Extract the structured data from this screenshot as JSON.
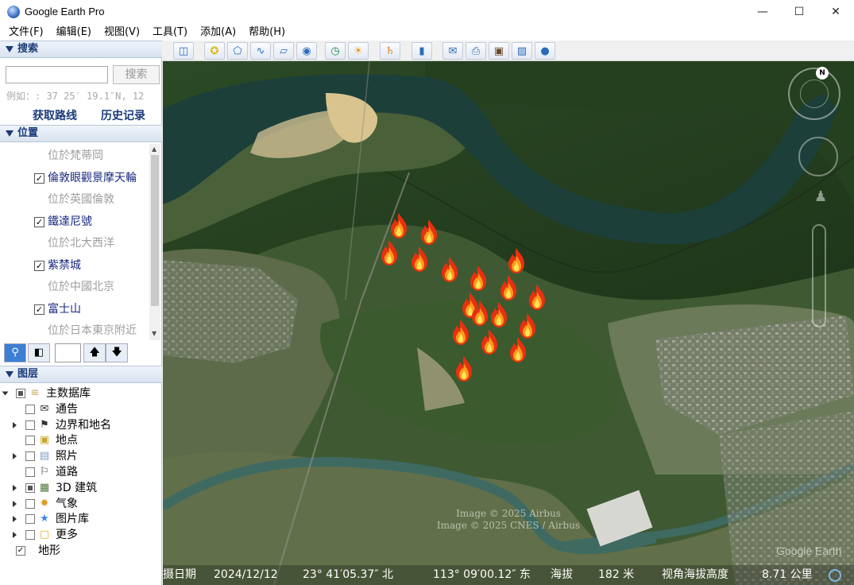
{
  "window": {
    "title": "Google Earth Pro"
  },
  "menu": [
    "文件(F)",
    "编辑(E)",
    "视图(V)",
    "工具(T)",
    "添加(A)",
    "帮助(H)"
  ],
  "search": {
    "header": "搜索",
    "input_value": "",
    "button_label": "搜索",
    "hint": "例如：: 37 25′ 19.1″N, 12",
    "link_directions": "获取路线",
    "link_history": "历史记录"
  },
  "places": {
    "header": "位置",
    "items": [
      {
        "type": "sub",
        "text": "位於梵蒂岡"
      },
      {
        "type": "main",
        "text": "倫敦眼觀景摩天輪",
        "checked": true
      },
      {
        "type": "sub",
        "text": "位於英國倫敦"
      },
      {
        "type": "main",
        "text": "鐵達尼號",
        "checked": true
      },
      {
        "type": "sub",
        "text": "位於北大西洋"
      },
      {
        "type": "main",
        "text": "紫禁城",
        "checked": true
      },
      {
        "type": "sub",
        "text": "位於中國北京"
      },
      {
        "type": "main",
        "text": "富士山",
        "checked": true
      },
      {
        "type": "sub",
        "text": "位於日本東京附近"
      }
    ]
  },
  "layers": {
    "header": "图层",
    "items": [
      {
        "label": "主数据库",
        "state": "partial",
        "icon": "layers-icon",
        "indent": 0,
        "expander": true,
        "expanded": true
      },
      {
        "label": "通告",
        "state": "off",
        "icon": "envelope-icon",
        "indent": 1,
        "expander": false
      },
      {
        "label": "边界和地名",
        "state": "off",
        "icon": "flag-icon",
        "indent": 1,
        "expander": true
      },
      {
        "label": "地点",
        "state": "off",
        "icon": "place-icon",
        "indent": 1,
        "expander": false
      },
      {
        "label": "照片",
        "state": "off",
        "icon": "photo-icon",
        "indent": 1,
        "expander": true
      },
      {
        "label": "道路",
        "state": "off",
        "icon": "road-icon",
        "indent": 1,
        "expander": false
      },
      {
        "label": "3D 建筑",
        "state": "partial",
        "icon": "building-icon",
        "indent": 1,
        "expander": true
      },
      {
        "label": "气象",
        "state": "off",
        "icon": "weather-icon",
        "indent": 1,
        "expander": true
      },
      {
        "label": "图片库",
        "state": "off",
        "icon": "gallery-icon",
        "indent": 1,
        "expander": true
      },
      {
        "label": "更多",
        "state": "off",
        "icon": "more-icon",
        "indent": 1,
        "expander": true
      },
      {
        "label": "地形",
        "state": "on",
        "icon": "",
        "indent": 0,
        "expander": false
      }
    ]
  },
  "toolbar": [
    "sidebar-toggle-icon",
    "placemark-icon",
    "polygon-icon",
    "path-icon",
    "overlay-icon",
    "tour-icon",
    "history-icon",
    "sun-icon",
    "planets-icon",
    "ruler-icon",
    "email-icon",
    "print-icon",
    "save-image-icon",
    "save-image-view-icon",
    "maps-icon"
  ],
  "map": {
    "attribution": [
      "Image © 2025 Airbus",
      "Image © 2025 CNES / Airbus"
    ],
    "logo": "Google Earth",
    "compass_label": "N",
    "status": {
      "date_label": "摄日期",
      "date_value": "2024/12/12",
      "lat": "23° 41′05.37″ 北",
      "lon": "113° 09′00.12″ 东",
      "elev_label": "海拔",
      "elev_value": "182 米",
      "eye_label": "视角海拔高度",
      "eye_value": "8.71 公里"
    },
    "fire_count": 17
  }
}
